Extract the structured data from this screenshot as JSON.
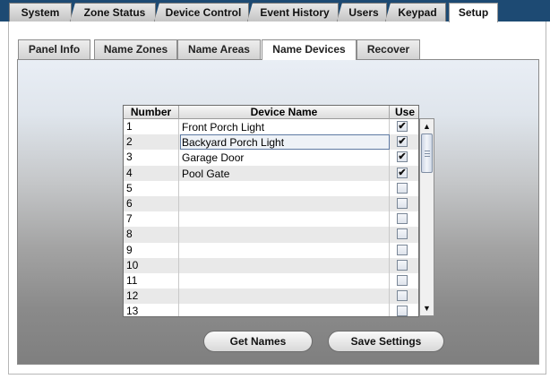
{
  "top_tabs": [
    {
      "label": "System"
    },
    {
      "label": "Zone Status"
    },
    {
      "label": "Device Control"
    },
    {
      "label": "Event History"
    },
    {
      "label": "Users"
    },
    {
      "label": "Keypad"
    },
    {
      "label": "Setup",
      "active": true
    }
  ],
  "sub_tabs": [
    {
      "label": "Panel Info"
    },
    {
      "label": "Name Zones"
    },
    {
      "label": "Name Areas"
    },
    {
      "label": "Name Devices",
      "active": true
    },
    {
      "label": "Recover"
    }
  ],
  "table": {
    "columns": [
      "Number",
      "Device Name",
      "Use"
    ],
    "rows": [
      {
        "number": "1",
        "name": "Front Porch Light",
        "use": true
      },
      {
        "number": "2",
        "name": "Backyard Porch Light",
        "use": true,
        "selected": true
      },
      {
        "number": "3",
        "name": "Garage Door",
        "use": true
      },
      {
        "number": "4",
        "name": "Pool Gate",
        "use": true
      },
      {
        "number": "5",
        "name": "",
        "use": false
      },
      {
        "number": "6",
        "name": "",
        "use": false
      },
      {
        "number": "7",
        "name": "",
        "use": false
      },
      {
        "number": "8",
        "name": "",
        "use": false
      },
      {
        "number": "9",
        "name": "",
        "use": false
      },
      {
        "number": "10",
        "name": "",
        "use": false
      },
      {
        "number": "11",
        "name": "",
        "use": false
      },
      {
        "number": "12",
        "name": "",
        "use": false
      },
      {
        "number": "13",
        "name": "",
        "use": false
      }
    ]
  },
  "buttons": {
    "get_names": "Get Names",
    "save_settings": "Save Settings"
  },
  "icons": {
    "scroll_up": "scroll-up-arrow",
    "scroll_down": "scroll-down-arrow",
    "checkmark": "checkmark"
  },
  "colors": {
    "top_bar": "#1d4a73",
    "selected_border": "#5e7aa3"
  }
}
